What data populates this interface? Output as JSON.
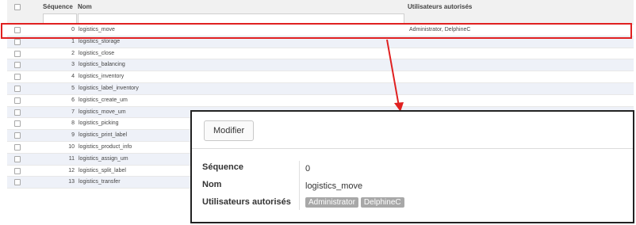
{
  "list": {
    "columns": {
      "sequence": "Séquence",
      "nom": "Nom",
      "utilisateurs": "Utilisateurs autorisés"
    },
    "rows": [
      {
        "seq": "0",
        "nom": "logistics_move",
        "users": "Administrator, DelphineC"
      },
      {
        "seq": "1",
        "nom": "logistics_storage",
        "users": ""
      },
      {
        "seq": "2",
        "nom": "logistics_close",
        "users": ""
      },
      {
        "seq": "3",
        "nom": "logistics_balancing",
        "users": ""
      },
      {
        "seq": "4",
        "nom": "logistics_inventory",
        "users": ""
      },
      {
        "seq": "5",
        "nom": "logistics_label_inventory",
        "users": ""
      },
      {
        "seq": "6",
        "nom": "logistics_create_um",
        "users": ""
      },
      {
        "seq": "7",
        "nom": "logistics_move_um",
        "users": ""
      },
      {
        "seq": "8",
        "nom": "logistics_picking",
        "users": ""
      },
      {
        "seq": "9",
        "nom": "logistics_print_label",
        "users": ""
      },
      {
        "seq": "10",
        "nom": "logistics_product_info",
        "users": ""
      },
      {
        "seq": "11",
        "nom": "logistics_assign_um",
        "users": ""
      },
      {
        "seq": "12",
        "nom": "logistics_split_label",
        "users": ""
      },
      {
        "seq": "13",
        "nom": "logistics_transfer",
        "users": ""
      }
    ]
  },
  "highlight_color": "#e02020",
  "detail": {
    "button_label": "Modifier",
    "fields": {
      "sequence_label": "Séquence",
      "sequence_value": "0",
      "nom_label": "Nom",
      "nom_value": "logistics_move",
      "users_label": "Utilisateurs autorisés",
      "users_tags": [
        "Administrator",
        "DelphineC"
      ]
    }
  }
}
